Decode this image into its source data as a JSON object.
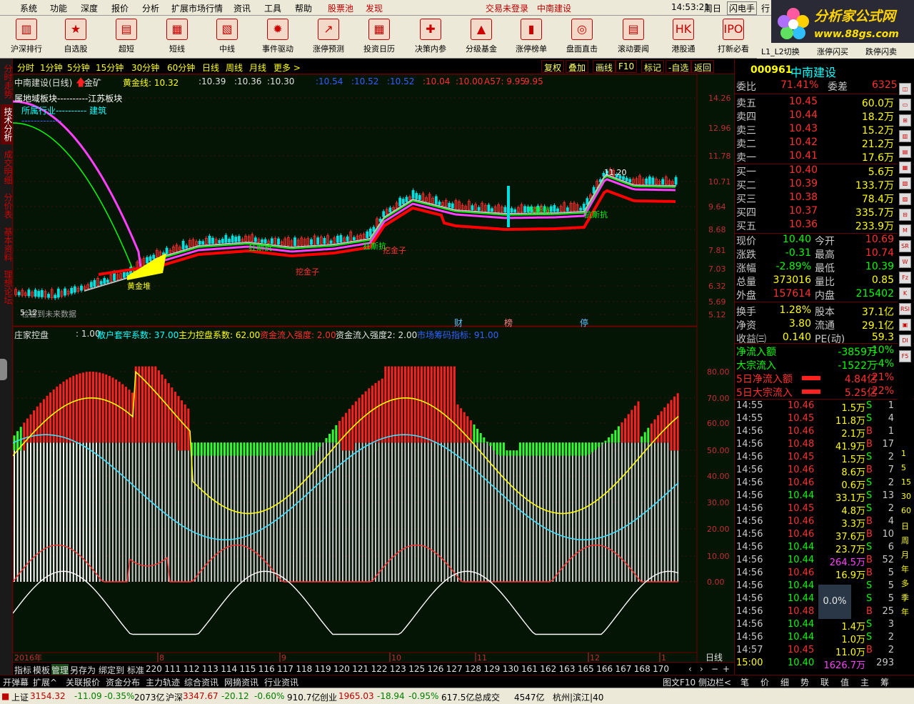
{
  "menu": {
    "items": [
      "系统",
      "功能",
      "深度",
      "报价",
      "分析",
      "扩展市场行情",
      "资讯",
      "工具",
      "帮助"
    ],
    "highlight": [
      "股票池",
      "发现"
    ],
    "login": "交易未登录",
    "stock_name": "中南建设",
    "time": "14:53:21",
    "weekday": "周日",
    "mode": "闪电手",
    "trade": "行"
  },
  "logo": {
    "line1": "分析家公式网",
    "line2": "www.88gs.com"
  },
  "toolbar": [
    "沪深排行",
    "自选股",
    "超短",
    "短线",
    "中线",
    "事件驱动",
    "涨停预测",
    "投资日历",
    "决策内参",
    "分级基金",
    "涨停榜单",
    "盘面直击",
    "滚动要闻",
    "港股通",
    "打新必看",
    "L1_L2切换",
    "涨停闪买",
    "跌停闪卖"
  ],
  "left_tabs": [
    "分时走势",
    "技术分析",
    "成交明细",
    "分价表",
    "基本资料",
    "理想论坛"
  ],
  "periods": [
    "分时",
    "1分钟",
    "5分钟",
    "15分钟",
    "30分钟",
    "60分钟",
    "日线",
    "周线",
    "月线",
    "更多 >"
  ],
  "period_buttons": [
    "复权",
    "叠加",
    "画线",
    "F10",
    "标记",
    "-自选",
    "返回"
  ],
  "main_chart": {
    "title": "中南建设(日线)",
    "indicator": "金矿",
    "gold_line_label": "黄金线: 10.32",
    "values": [
      ":10.39",
      ":10.36",
      ":10.30",
      ":10.54",
      ":10.52",
      ":10.52",
      ":10.04",
      ":10.00",
      "A57: 9.95",
      "9.95"
    ],
    "info1": "属地域板块----------江苏板块",
    "info2": "所属行业---------- 建筑",
    "info3": "-------------",
    "yticks": [
      "14.26",
      "12.96",
      "11.78",
      "10.71",
      "9.64",
      "8.68",
      "7.81",
      "7.03",
      "6.32",
      "5.69",
      "5.12"
    ],
    "annotations": [
      "黄金堆",
      "挖金子",
      "挖金子",
      "狂斯抗",
      "狂斯抗",
      "抗斯抗",
      "万斯抗",
      "11.20"
    ],
    "footer_text": "检查到未来数据",
    "low_label": "5.12",
    "events": [
      "财",
      "榜",
      "停"
    ]
  },
  "sub_chart": {
    "title": "庄家控盘",
    "params": [
      ": 1.00",
      "散户套牢系数: 37.00",
      "主力控盘系数: 62.00",
      "资金流入强度: 2.00",
      "资金流入强度2: 2.00",
      "市场筹码指标: 91.00"
    ],
    "yticks": [
      "80.00",
      "70.00",
      "60.00",
      "50.00",
      "40.00",
      "30.00",
      "20.00",
      "10.00",
      "0.00"
    ]
  },
  "xaxis": {
    "labels": [
      "2016年",
      "8",
      "9",
      "10",
      "11",
      "12",
      "1"
    ],
    "mode": "日线"
  },
  "bottom_tabs": [
    "指标",
    "模板",
    "管理",
    "另存为",
    "绑定到",
    "标准",
    "220",
    "111",
    "112",
    "113",
    "114",
    "115",
    "116",
    "117",
    "118",
    "119",
    "120",
    "121",
    "122",
    "123",
    "125",
    "126",
    "127",
    "128",
    "129",
    "130",
    "161",
    "162",
    "163",
    "165",
    "166",
    "167",
    "168",
    "170"
  ],
  "bottom_tabs2": [
    "开弹幕",
    "扩展^",
    "关联报价",
    "资金分布",
    "主力轨迹",
    "综合资讯",
    "网摘资讯",
    "行业资讯"
  ],
  "bottom_tabs2_right": [
    "图文F10",
    "侧边栏<"
  ],
  "quote": {
    "code": "000961",
    "name": "中南建设",
    "weibi_label": "委比",
    "weibi": "71.41%",
    "weicha_label": "委差",
    "weicha": "6325",
    "sells": [
      {
        "label": "卖五",
        "price": "10.45",
        "vol": "60.0万"
      },
      {
        "label": "卖四",
        "price": "10.44",
        "vol": "18.2万"
      },
      {
        "label": "卖三",
        "price": "10.43",
        "vol": "15.2万"
      },
      {
        "label": "卖二",
        "price": "10.42",
        "vol": "21.2万"
      },
      {
        "label": "卖一",
        "price": "10.41",
        "vol": "17.6万"
      }
    ],
    "buys": [
      {
        "label": "买一",
        "price": "10.40",
        "vol": "5.6万"
      },
      {
        "label": "买二",
        "price": "10.39",
        "vol": "133.7万"
      },
      {
        "label": "买三",
        "price": "10.38",
        "vol": "78.4万"
      },
      {
        "label": "买四",
        "price": "10.37",
        "vol": "335.7万"
      },
      {
        "label": "买五",
        "price": "10.36",
        "vol": "233.9万"
      }
    ],
    "stats": [
      {
        "l1": "现价",
        "v1": "10.40",
        "l2": "今开",
        "v2": "10.69"
      },
      {
        "l1": "涨跌",
        "v1": "-0.31",
        "l2": "最高",
        "v2": "10.74"
      },
      {
        "l1": "涨幅",
        "v1": "-2.89%",
        "l2": "最低",
        "v2": "10.39"
      },
      {
        "l1": "总量",
        "v1": "373016",
        "l2": "量比",
        "v2": "0.85"
      },
      {
        "l1": "外盘",
        "v1": "157614",
        "l2": "内盘",
        "v2": "215402"
      },
      {
        "l1": "换手",
        "v1": "1.28%",
        "l2": "股本",
        "v2": "37.1亿"
      },
      {
        "l1": "净资",
        "v1": "3.80",
        "l2": "流通",
        "v2": "29.1亿"
      },
      {
        "l1": "收益㈢",
        "v1": "0.140",
        "l2": "PE(动)",
        "v2": "59.3"
      }
    ],
    "flows": [
      {
        "label": "净流入额",
        "v": "-3859万",
        "p": "-10%"
      },
      {
        "label": "大宗流入",
        "v": "-1522万",
        "p": "-4%"
      },
      {
        "label": "5日净流入额",
        "v": "4.84亿",
        "p": "21%"
      },
      {
        "label": "5日大宗流入",
        "v": "5.25亿",
        "p": "22%"
      }
    ],
    "ticks": [
      {
        "t": "14:55",
        "p": "10.46",
        "v": "1.5万",
        "s": "S",
        "n": "1"
      },
      {
        "t": "14:55",
        "p": "10.45",
        "v": "11.8万",
        "s": "S",
        "n": "4"
      },
      {
        "t": "14:56",
        "p": "10.46",
        "v": "2.1万",
        "s": "B",
        "n": "1"
      },
      {
        "t": "14:56",
        "p": "10.48",
        "v": "41.9万",
        "s": "B",
        "n": "17"
      },
      {
        "t": "14:56",
        "p": "10.45",
        "v": "1.5万",
        "s": "S",
        "n": "2"
      },
      {
        "t": "14:56",
        "p": "10.46",
        "v": "8.6万",
        "s": "B",
        "n": "7"
      },
      {
        "t": "14:56",
        "p": "10.46",
        "v": "0.6万",
        "s": "S",
        "n": "2"
      },
      {
        "t": "14:56",
        "p": "10.44",
        "v": "33.1万",
        "s": "S",
        "n": "13"
      },
      {
        "t": "14:56",
        "p": "10.45",
        "v": "4.8万",
        "s": "S",
        "n": "2"
      },
      {
        "t": "14:56",
        "p": "10.46",
        "v": "3.3万",
        "s": "B",
        "n": "4"
      },
      {
        "t": "14:56",
        "p": "10.46",
        "v": "37.6万",
        "s": "B",
        "n": "10"
      },
      {
        "t": "14:56",
        "p": "10.44",
        "v": "23.7万",
        "s": "S",
        "n": "6"
      },
      {
        "t": "14:56",
        "p": "10.44",
        "v": "264.5万",
        "s": "B",
        "n": "52"
      },
      {
        "t": "14:56",
        "p": "10.46",
        "v": "16.9万",
        "s": "B",
        "n": "5"
      },
      {
        "t": "14:56",
        "p": "10.44",
        "v": "",
        "s": "S",
        "n": "5"
      },
      {
        "t": "14:56",
        "p": "10.44",
        "v": "",
        "s": "S",
        "n": "5"
      },
      {
        "t": "14:56",
        "p": "10.48",
        "v": "",
        "s": "B",
        "n": "25"
      },
      {
        "t": "14:56",
        "p": "10.44",
        "v": "1.4万",
        "s": "S",
        "n": "3"
      },
      {
        "t": "14:56",
        "p": "10.44",
        "v": "1.0万",
        "s": "S",
        "n": "2"
      },
      {
        "t": "14:57",
        "p": "10.45",
        "v": "11.0万",
        "s": "B",
        "n": "2"
      },
      {
        "t": "15:00",
        "p": "10.40",
        "v": "1626.7万",
        "s": "",
        "n": "293"
      }
    ],
    "badge": "0.0%"
  },
  "side_icons": [
    "1",
    "5",
    "15",
    "30",
    "60",
    "日",
    "周",
    "月",
    "年",
    "多",
    "季",
    "年"
  ],
  "right_bottom_tabs": [
    "笔",
    "价",
    "细",
    "势",
    "联",
    "值",
    "主",
    "筹"
  ],
  "status": {
    "sh": "上证",
    "sh_v": "3154.32",
    "sh_c": "-11.09",
    "sh_p": "-0.35%",
    "sh_a": "2073亿",
    "hs": "沪深",
    "hs_v": "3347.67",
    "hs_c": "-20.12",
    "hs_p": "-0.60%",
    "hs_a": "910.7亿",
    "cy": "创业",
    "cy_v": "1965.03",
    "cy_c": "-18.94",
    "cy_p": "-0.95%",
    "cy_a": "617.5亿",
    "total_label": "总成交",
    "total": "4547亿",
    "site": "杭州|滨江|40"
  },
  "colors": {
    "up": "#ff3030",
    "down": "#00ff00",
    "label": "#ffff00",
    "bg": "#051505"
  }
}
